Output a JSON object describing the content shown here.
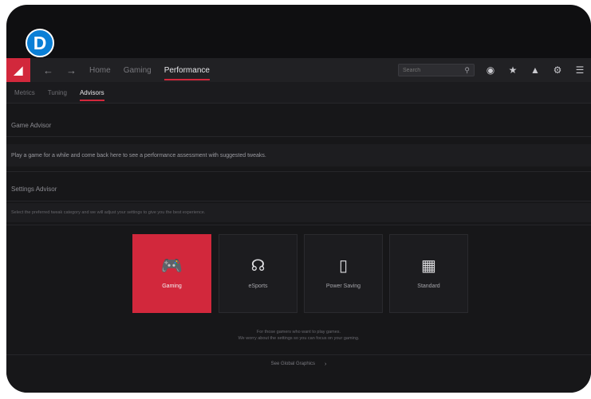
{
  "badge": {
    "letter": "D",
    "color": "#0a7fd6"
  },
  "accent": "#d2283c",
  "topbar": {
    "logo_icon": "amd-logo-icon",
    "back_icon": "arrow-left-icon",
    "forward_icon": "arrow-right-icon",
    "nav": [
      "Home",
      "Gaming",
      "Performance"
    ],
    "active_nav": "Performance",
    "search_placeholder": "Search",
    "icons": [
      "search-icon",
      "globe-icon",
      "star-icon",
      "bell-icon",
      "gear-icon",
      "menu-icon"
    ]
  },
  "subtabs": [
    "Metrics",
    "Tuning",
    "Advisors"
  ],
  "active_subtab": "Advisors",
  "game_advisor": {
    "title": "Game Advisor",
    "text": "Play a game for a while and come back here to see a performance assessment with suggested tweaks."
  },
  "settings_advisor": {
    "title": "Settings Advisor",
    "text": "Select the preferred tweak category and we will adjust your settings to give you the best experience."
  },
  "profiles": [
    {
      "label": "Gaming",
      "icon": "gamepad-icon",
      "selected": true
    },
    {
      "label": "eSports",
      "icon": "headset-icon",
      "selected": false
    },
    {
      "label": "Power Saving",
      "icon": "battery-icon",
      "selected": false
    },
    {
      "label": "Standard",
      "icon": "blocks-icon",
      "selected": false
    }
  ],
  "profile_description": [
    "For those gamers who want to play games.",
    "We worry about the settings so you can focus on your gaming."
  ],
  "footer": {
    "label": "See Global Graphics",
    "chevron_icon": "chevron-right-icon"
  }
}
